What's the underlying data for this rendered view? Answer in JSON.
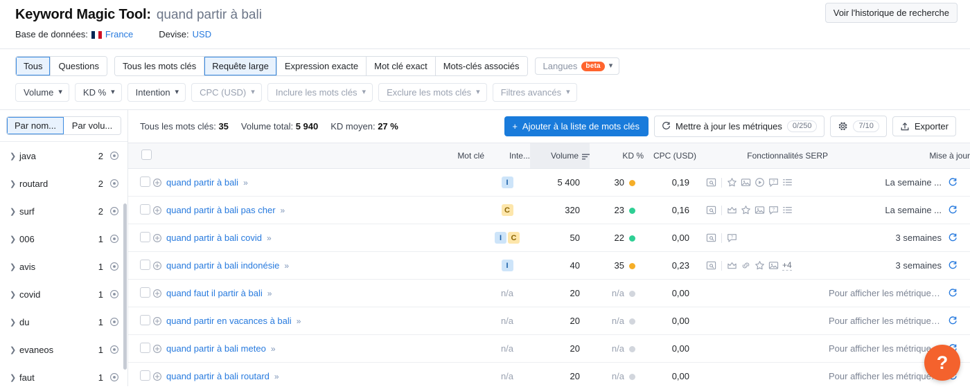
{
  "header": {
    "tool_title": "Keyword Magic Tool:",
    "keyword": "quand partir à bali",
    "database_label": "Base de données:",
    "database_value": "France",
    "currency_label": "Devise:",
    "currency_value": "USD",
    "history_button": "Voir l'historique de recherche"
  },
  "tabs": {
    "group1": [
      {
        "label": "Tous",
        "active": true
      },
      {
        "label": "Questions",
        "active": false
      }
    ],
    "group2": [
      {
        "label": "Tous les mots clés",
        "active": false
      },
      {
        "label": "Requête large",
        "active": true
      },
      {
        "label": "Expression exacte",
        "active": false
      },
      {
        "label": "Mot clé exact",
        "active": false
      },
      {
        "label": "Mots-clés associés",
        "active": false
      }
    ],
    "languages": {
      "label": "Langues",
      "badge": "beta"
    }
  },
  "filters": [
    {
      "label": "Volume",
      "dark": true
    },
    {
      "label": "KD %",
      "dark": true
    },
    {
      "label": "Intention",
      "dark": true
    },
    {
      "label": "CPC (USD)",
      "dark": false
    },
    {
      "label": "Inclure les mots clés",
      "dark": false
    },
    {
      "label": "Exclure les mots clés",
      "dark": false
    },
    {
      "label": "Filtres avancés",
      "dark": false
    }
  ],
  "sidebar": {
    "toggle": [
      {
        "label": "Par nom...",
        "active": true
      },
      {
        "label": "Par volu...",
        "active": false
      }
    ],
    "items": [
      {
        "name": "java",
        "count": "2"
      },
      {
        "name": "routard",
        "count": "2"
      },
      {
        "name": "surf",
        "count": "2"
      },
      {
        "name": "006",
        "count": "1"
      },
      {
        "name": "avis",
        "count": "1"
      },
      {
        "name": "covid",
        "count": "1"
      },
      {
        "name": "du",
        "count": "1"
      },
      {
        "name": "evaneos",
        "count": "1"
      },
      {
        "name": "faut",
        "count": "1"
      }
    ]
  },
  "toolbar": {
    "total_keywords_label": "Tous les mots clés:",
    "total_keywords_value": "35",
    "total_volume_label": "Volume total:",
    "total_volume_value": "5 940",
    "avg_kd_label": "KD moyen:",
    "avg_kd_value": "27 %",
    "add_to_list_button": "Ajouter à la liste de mots clés",
    "update_metrics_button": "Mettre à jour les métriques",
    "update_metrics_chip": "0/250",
    "settings_chip": "7/10",
    "export_button": "Exporter"
  },
  "table": {
    "columns": {
      "keyword": "Mot clé",
      "intent": "Inte...",
      "volume": "Volume",
      "kd": "KD %",
      "cpc": "CPC (USD)",
      "serp": "Fonctionnalités SERP",
      "updated": "Mise à jour"
    },
    "rows": [
      {
        "keyword": "quand partir à bali",
        "intents": [
          "I"
        ],
        "volume": "5 400",
        "kd": "30",
        "kd_color": "#f5ae28",
        "cpc": "0,19",
        "serp": [
          "serp-preview-icon",
          "divider",
          "star-icon",
          "image-icon",
          "video-icon",
          "faq-icon",
          "list-icon"
        ],
        "serp_more": "",
        "updated": "La semaine ...",
        "updated_muted": false
      },
      {
        "keyword": "quand partir à bali pas cher",
        "intents": [
          "C"
        ],
        "volume": "320",
        "kd": "23",
        "kd_color": "#2ecf94",
        "cpc": "0,16",
        "serp": [
          "serp-preview-icon",
          "divider",
          "crown-icon",
          "star-icon",
          "image-icon",
          "faq-icon",
          "list-icon"
        ],
        "serp_more": "",
        "updated": "La semaine ...",
        "updated_muted": false
      },
      {
        "keyword": "quand partir à bali covid",
        "intents": [
          "I",
          "C"
        ],
        "volume": "50",
        "kd": "22",
        "kd_color": "#2ecf94",
        "cpc": "0,00",
        "serp": [
          "serp-preview-icon",
          "divider",
          "faq-icon"
        ],
        "serp_more": "",
        "updated": "3 semaines",
        "updated_muted": false
      },
      {
        "keyword": "quand partir à bali indonésie",
        "intents": [
          "I"
        ],
        "volume": "40",
        "kd": "35",
        "kd_color": "#f5ae28",
        "cpc": "0,23",
        "serp": [
          "serp-preview-icon",
          "divider",
          "crown-icon",
          "link-icon",
          "star-icon",
          "image-icon"
        ],
        "serp_more": "+4",
        "updated": "3 semaines",
        "updated_muted": false
      },
      {
        "keyword": "quand faut il partir à bali",
        "intents": [],
        "volume": "20",
        "kd": "n/a",
        "kd_color": "#d2d6dd",
        "cpc": "0,00",
        "serp": [],
        "serp_more": "",
        "updated": "Pour afficher les métriques, actua...",
        "updated_muted": true
      },
      {
        "keyword": "quand partir en vacances à bali",
        "intents": [],
        "volume": "20",
        "kd": "n/a",
        "kd_color": "#d2d6dd",
        "cpc": "0,00",
        "serp": [],
        "serp_more": "",
        "updated": "Pour afficher les métriques, actua...",
        "updated_muted": true
      },
      {
        "keyword": "quand partir à bali meteo",
        "intents": [],
        "volume": "20",
        "kd": "n/a",
        "kd_color": "#d2d6dd",
        "cpc": "0,00",
        "serp": [],
        "serp_more": "",
        "updated": "Pour afficher les métriques, actua...",
        "updated_muted": true
      },
      {
        "keyword": "quand partir à bali routard",
        "intents": [],
        "volume": "20",
        "kd": "n/a",
        "kd_color": "#d2d6dd",
        "cpc": "0,00",
        "serp": [],
        "serp_more": "",
        "updated": "Pour afficher les métriques, actua...",
        "updated_muted": true
      }
    ]
  },
  "help": {
    "label": "?"
  },
  "colors": {
    "accent_blue": "#197bdb",
    "link_blue": "#277ade",
    "beta_orange": "#ff642d",
    "help_orange": "#f4622d",
    "kd_green": "#2ecf94",
    "kd_yellow": "#f5ae28",
    "kd_gray": "#d2d6dd"
  }
}
